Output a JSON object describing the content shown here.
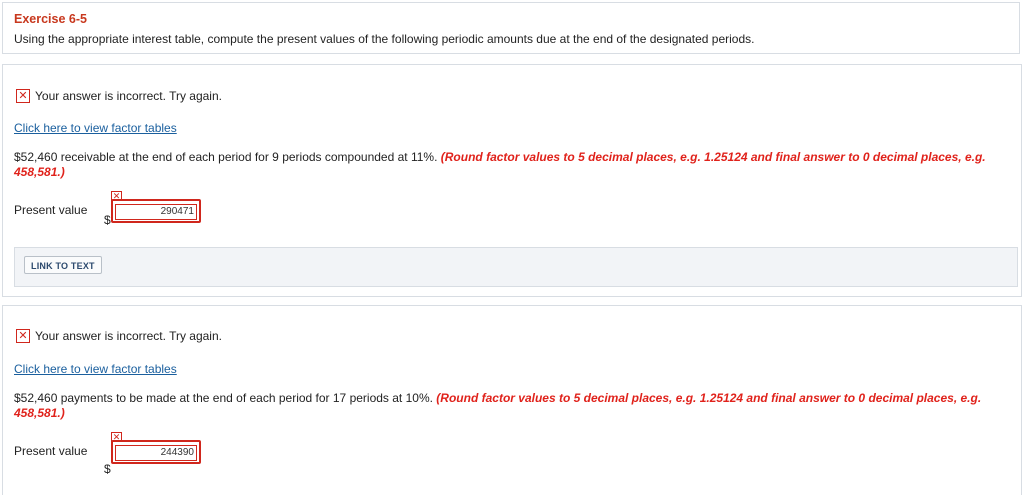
{
  "exercise": {
    "title": "Exercise 6-5",
    "description": "Using the appropriate interest table, compute the present values of the following periodic amounts due at the end of the designated periods."
  },
  "parts": [
    {
      "feedback": "Your answer is incorrect.  Try again.",
      "factor_link": "Click here to view factor tables",
      "question": "$52,460 receivable at the end of each period for 9 periods compounded at 11%.",
      "instructions": "(Round factor values to 5 decimal places, e.g. 1.25124 and final answer to 0 decimal places, e.g. 458,581.)",
      "answer_label": "Present value",
      "currency": "$",
      "answer_value": "290471",
      "link_to_text": "LINK TO TEXT"
    },
    {
      "feedback": "Your answer is incorrect.  Try again.",
      "factor_link": "Click here to view factor tables",
      "question": "$52,460 payments to be made at the end of each period for 17 periods at 10%.",
      "instructions": "(Round factor values to 5 decimal places, e.g. 1.25124 and final answer to 0 decimal places, e.g. 458,581.)",
      "answer_label": "Present value",
      "currency": "$",
      "answer_value": "244390"
    }
  ],
  "colors": {
    "title": "#c8381e",
    "error": "#d0271d",
    "instruction": "#e0221b",
    "link": "#1a5f9e"
  },
  "icons": {
    "incorrect": "x-mark-icon"
  }
}
